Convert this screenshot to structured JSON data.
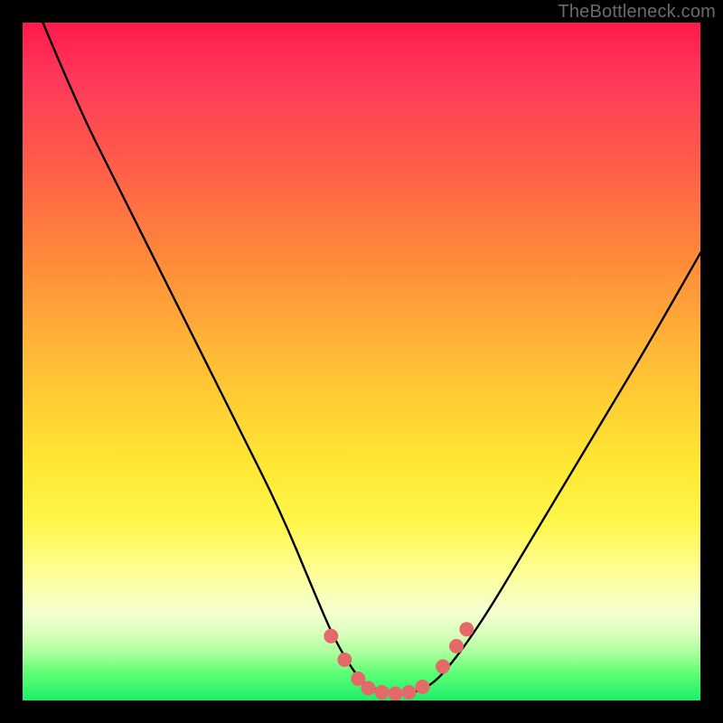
{
  "watermark": "TheBottleneck.com",
  "chart_data": {
    "type": "line",
    "title": "",
    "xlabel": "",
    "ylabel": "",
    "xlim": [
      0,
      100
    ],
    "ylim": [
      0,
      100
    ],
    "series": [
      {
        "name": "bottleneck-curve",
        "x": [
          3,
          8,
          14,
          20,
          26,
          32,
          38,
          43,
          46,
          49,
          51,
          54,
          57,
          60,
          63,
          68,
          74,
          80,
          86,
          92,
          100
        ],
        "y": [
          100,
          88,
          76,
          64,
          52,
          40,
          28,
          16,
          9,
          4,
          2,
          1,
          1,
          2,
          5,
          12,
          22,
          32,
          42,
          52,
          66
        ]
      }
    ],
    "markers": {
      "name": "highlight-dots",
      "color": "#e46a6a",
      "points": [
        {
          "x": 45.5,
          "y": 9.5
        },
        {
          "x": 47.5,
          "y": 6.0
        },
        {
          "x": 49.5,
          "y": 3.2
        },
        {
          "x": 51.0,
          "y": 1.8
        },
        {
          "x": 53.0,
          "y": 1.2
        },
        {
          "x": 55.0,
          "y": 1.0
        },
        {
          "x": 57.0,
          "y": 1.2
        },
        {
          "x": 59.0,
          "y": 2.0
        },
        {
          "x": 62.0,
          "y": 5.0
        },
        {
          "x": 64.0,
          "y": 8.0
        },
        {
          "x": 65.5,
          "y": 10.5
        }
      ]
    }
  }
}
